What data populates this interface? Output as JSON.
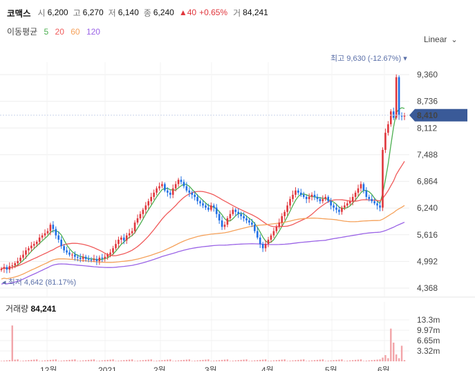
{
  "header": {
    "name": "코맥스",
    "open_label": "시",
    "open": "6,200",
    "high_label": "고",
    "high": "6,270",
    "low_label": "저",
    "low": "6,140",
    "close_label": "종",
    "close": "6,240",
    "change": "▲40",
    "change_pct": "+0.65%",
    "volume_label": "거",
    "volume": "84,241"
  },
  "moving_average": {
    "label": "이동평균",
    "periods": [
      {
        "value": "5",
        "color": "#4caf50"
      },
      {
        "value": "20",
        "color": "#f05a5a"
      },
      {
        "value": "60",
        "color": "#f5a15a"
      },
      {
        "value": "120",
        "color": "#9a63e6"
      }
    ]
  },
  "scale_selector": {
    "label": "Linear"
  },
  "colors": {
    "up": "#e0363c",
    "down": "#1f6fe5",
    "price_badge": "#3a5a98",
    "volume": "#f2a4a8"
  },
  "chart_data": [
    {
      "type": "candlestick",
      "price_axis": {
        "ticks": [
          "9,360",
          "8,736",
          "8,112",
          "7,488",
          "6,864",
          "6,240",
          "5,616",
          "4,992",
          "4,368"
        ],
        "range": [
          4368,
          9360
        ]
      },
      "x_axis": {
        "tick_labels": [
          "12월",
          "2021",
          "2월",
          "3월",
          "4월",
          "5월",
          "6월"
        ]
      },
      "current_price_badge": "8,410",
      "high_annotation": {
        "label": "최고",
        "value": "9,630 (-12.67%)"
      },
      "low_annotation": {
        "label": "최저",
        "value": "4,642 (81.17%)"
      },
      "close_series": [
        4820,
        4860,
        4800,
        4880,
        4900,
        4950,
        5000,
        5080,
        5150,
        5250,
        5300,
        5360,
        5400,
        5450,
        5550,
        5600,
        5650,
        5700,
        5850,
        5750,
        5600,
        5500,
        5350,
        5250,
        5200,
        5150,
        5150,
        5100,
        5080,
        5050,
        5100,
        5050,
        5030,
        5020,
        5050,
        5000,
        5080,
        5060,
        5100,
        5150,
        5200,
        5300,
        5400,
        5500,
        5550,
        5480,
        5600,
        5650,
        5700,
        5900,
        6000,
        6100,
        6200,
        6300,
        6400,
        6500,
        6600,
        6700,
        6750,
        6800,
        6650,
        6600,
        6550,
        6700,
        6800,
        6900,
        6850,
        6750,
        6650,
        6600,
        6550,
        6500,
        6400,
        6350,
        6300,
        6250,
        6200,
        6300,
        6250,
        6100,
        5950,
        5800,
        5850,
        6000,
        6100,
        6200,
        6150,
        6100,
        6050,
        6000,
        5950,
        5900,
        5850,
        5700,
        5550,
        5400,
        5300,
        5400,
        5500,
        5600,
        5700,
        5800,
        5900,
        6050,
        6150,
        6300,
        6450,
        6550,
        6650,
        6600,
        6550,
        6500,
        6450,
        6500,
        6550,
        6500,
        6450,
        6400,
        6450,
        6500,
        6400,
        6300,
        6250,
        6200,
        6150,
        6250,
        6300,
        6350,
        6400,
        6500,
        6600,
        6700,
        6800,
        6650,
        6500,
        6450,
        6400,
        6350,
        6300,
        6250,
        7600,
        8000,
        8200,
        8500,
        8350,
        9300,
        8400,
        8380,
        8410
      ],
      "ma5_end": 8100,
      "ma20_end": 7050,
      "ma60_end": 6450,
      "ma120_end": 6250,
      "volume_axis": {
        "ticks": [
          "13.3m",
          "9.97m",
          "6.65m",
          "3.32m"
        ],
        "range": [
          0,
          16600000
        ]
      },
      "volume_label": "거래량",
      "volume_value": "84,241"
    }
  ]
}
